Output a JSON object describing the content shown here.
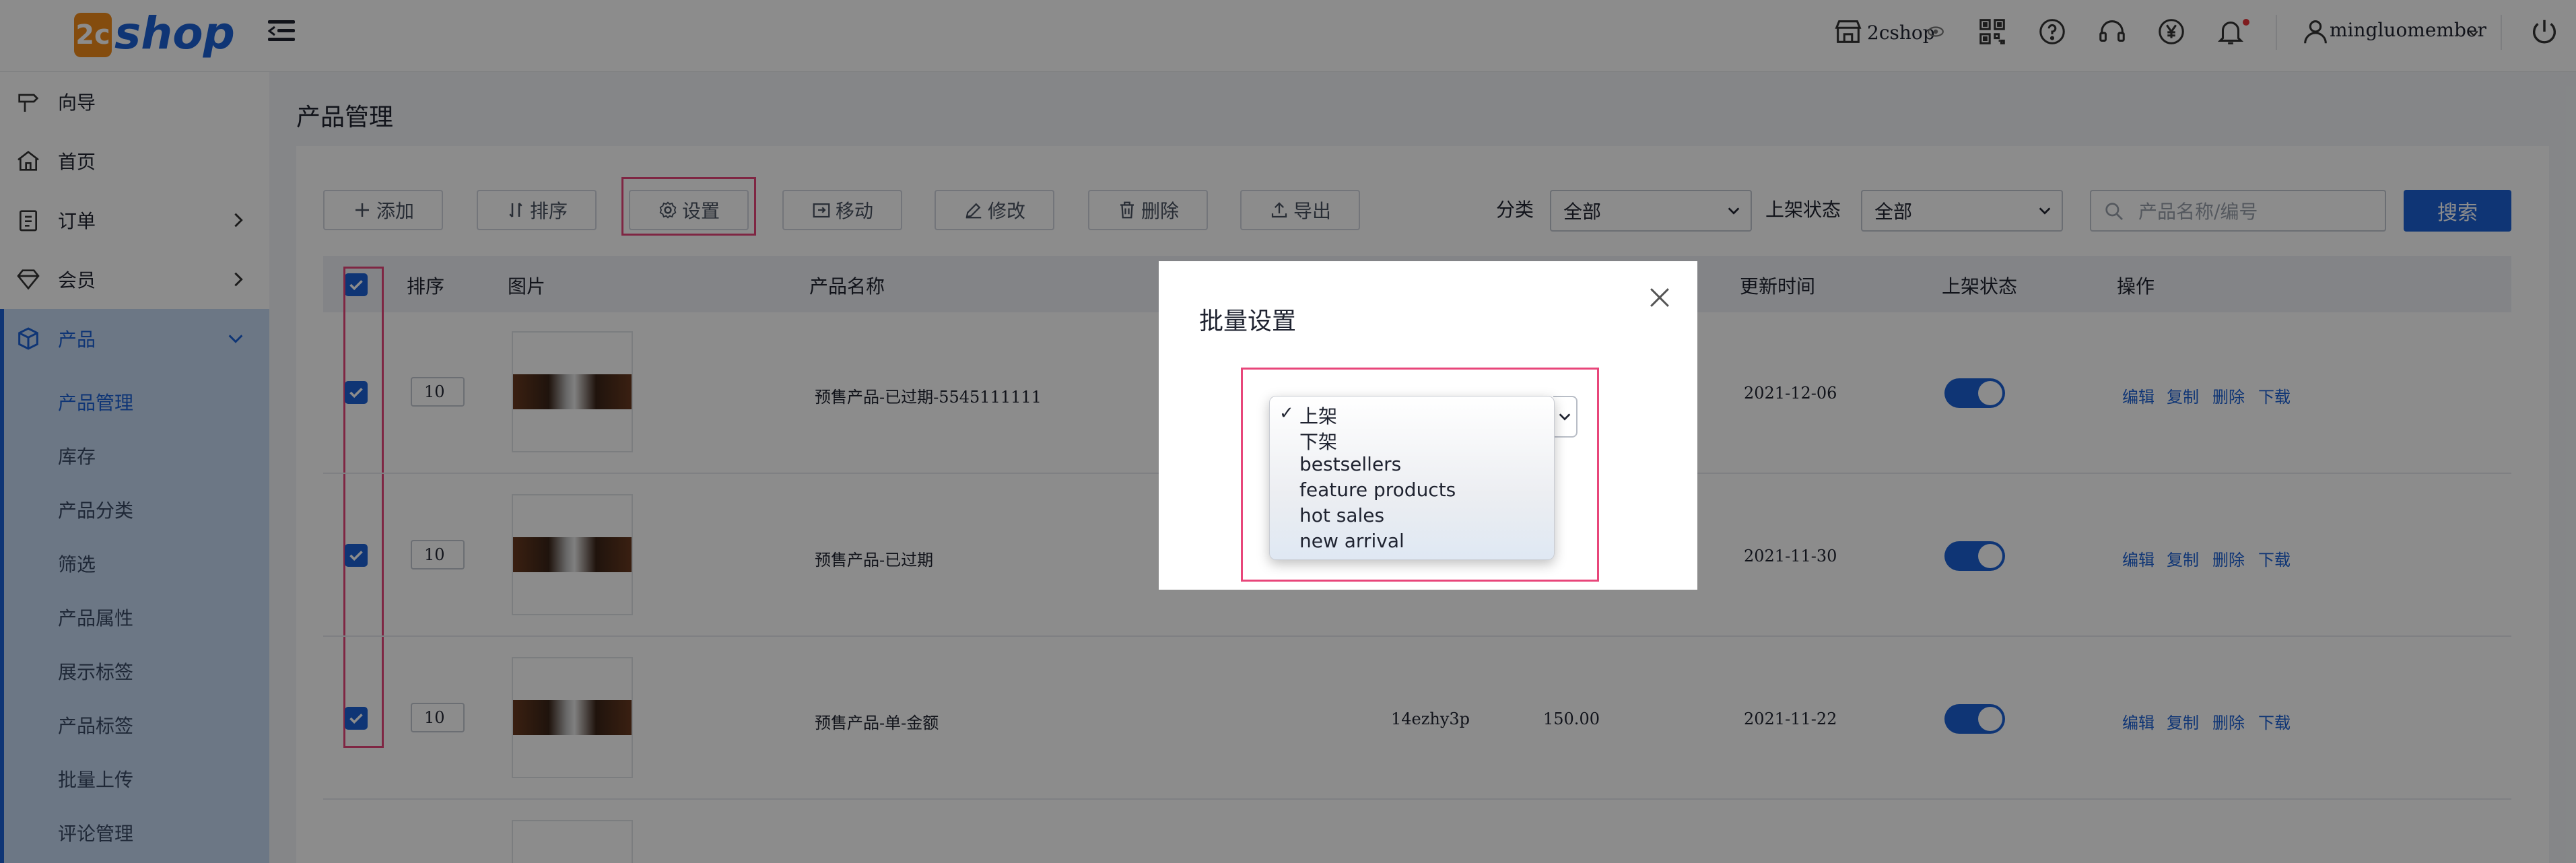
{
  "brand": {
    "logo_badge": "2c",
    "logo_word": "shop"
  },
  "topbar": {
    "store_name": "2cshop",
    "username": "mingluomember",
    "icons": [
      "store-icon",
      "eye-icon",
      "qrcode-icon",
      "help-icon",
      "headset-icon",
      "yen-icon",
      "bell-icon",
      "user-icon",
      "chevron-down-icon",
      "power-icon"
    ]
  },
  "sidebar": {
    "items": [
      {
        "label": "向导"
      },
      {
        "label": "首页"
      },
      {
        "label": "订单"
      },
      {
        "label": "会员"
      },
      {
        "label": "产品"
      }
    ],
    "sub_items": [
      {
        "label": "产品管理"
      },
      {
        "label": "库存"
      },
      {
        "label": "产品分类"
      },
      {
        "label": "筛选"
      },
      {
        "label": "产品属性"
      },
      {
        "label": "展示标签"
      },
      {
        "label": "产品标签"
      },
      {
        "label": "批量上传"
      },
      {
        "label": "评论管理"
      }
    ]
  },
  "main": {
    "page_title": "产品管理",
    "toolbar": {
      "add": "添加",
      "sort": "排序",
      "settings": "设置",
      "move": "移动",
      "edit": "修改",
      "delete": "删除",
      "export": "导出"
    },
    "filters": {
      "category_label": "分类",
      "category_value": "全部",
      "status_label": "上架状态",
      "status_value": "全部",
      "search_placeholder": "产品名称/编号",
      "search_button": "搜索"
    },
    "table": {
      "headers": {
        "sort": "排序",
        "image": "图片",
        "name": "产品名称",
        "updated": "更新时间",
        "status": "上架状态",
        "actions": "操作"
      },
      "rows": [
        {
          "sort": "10",
          "name": "预售产品-已过期-5545111111",
          "code": "",
          "price": "",
          "updated": "2021-12-06",
          "on_shelf": true
        },
        {
          "sort": "10",
          "name": "预售产品-已过期",
          "code": "",
          "price": "",
          "updated": "2021-11-30",
          "on_shelf": true
        },
        {
          "sort": "10",
          "name": "预售产品-单-金额",
          "code": "14ezhy3p",
          "price": "150.00",
          "updated": "2021-11-22",
          "on_shelf": true
        }
      ],
      "actions": {
        "edit": "编辑",
        "copy": "复制",
        "delete": "删除",
        "download": "下载"
      }
    }
  },
  "modal": {
    "title": "批量设置",
    "dropdown": {
      "selected": "上架",
      "options": [
        "上架",
        "下架",
        "bestsellers",
        "feature products",
        "hot sales",
        "new arrival"
      ]
    }
  },
  "colors": {
    "accent": "#1c62d6",
    "highlight": "#e8467a",
    "sidebar_active_bg": "#c5d9f3"
  }
}
